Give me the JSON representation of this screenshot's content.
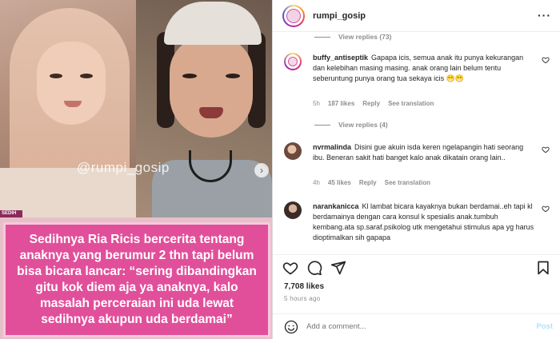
{
  "media": {
    "watermark": "@rumpi_gosip",
    "sedih_tag": "SEDIH",
    "caption": "Sedihnya Ria Ricis bercerita tentang anaknya yang berumur 2 thn tapi belum bisa bicara lancar: “sering dibandingkan gitu kok diem aja ya anaknya, kalo masalah perceraian ini uda lewat sedihnya akupun uda berdamai”",
    "caption_bg": "#e14f9a"
  },
  "header": {
    "username": "rumpi_gosip",
    "more_icon": "more-horizontal-icon"
  },
  "comments": {
    "view_replies_top": "View replies (73)",
    "items": [
      {
        "username": "buffy_antiseptik",
        "text": "Gapapa icis, semua anak itu punya kekurangan dan kelebihan masing masing. anak orang lain belum tentu seberuntung punya orang tua sekaya icis 😁😁",
        "time": "5h",
        "likes": "187 likes",
        "reply": "Reply",
        "see_translation": "See translation",
        "view_replies": "View replies (4)"
      },
      {
        "username": "nvrmalinda",
        "text": "Disini gue akuin isda keren ngelapangin hati seorang ibu. Beneran sakit hati banget kalo anak dikatain orang lain..",
        "time": "4h",
        "likes": "45 likes",
        "reply": "Reply",
        "see_translation": "See translation"
      },
      {
        "username": "narankanicca",
        "text": "Kl lambat bicara kayaknya bukan berdamai..eh tapi kl berdamainya dengan cara konsul k spesialis anak.tumbuh kembang.ata sp.saraf.psikolog utk mengetahui stimulus apa yg harus dioptimalkan sih gapapa"
      }
    ]
  },
  "actions": {
    "like_icon": "heart-icon",
    "comment_icon": "comment-icon",
    "share_icon": "send-icon",
    "save_icon": "bookmark-icon"
  },
  "likes": "7,708 likes",
  "time_ago": "5 hours ago",
  "add_comment": {
    "placeholder": "Add a comment...",
    "post_label": "Post"
  }
}
